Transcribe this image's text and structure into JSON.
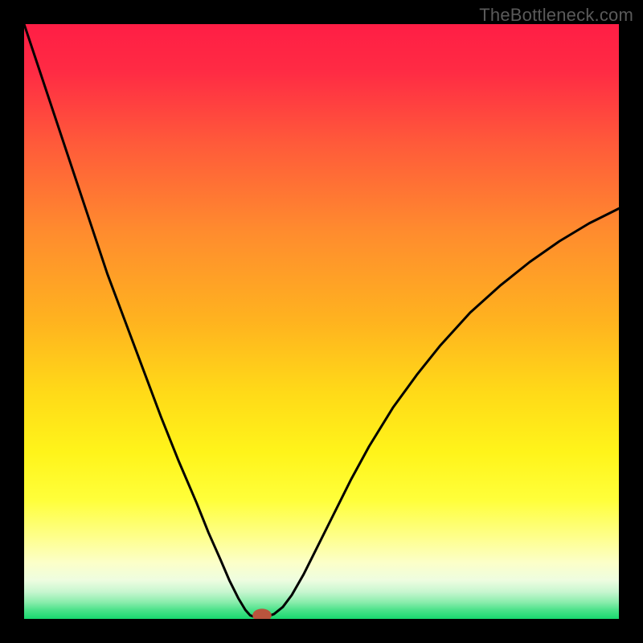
{
  "watermark": "TheBottleneck.com",
  "chart_data": {
    "type": "line",
    "title": "",
    "xlabel": "",
    "ylabel": "",
    "xlim": [
      0,
      100
    ],
    "ylim": [
      0,
      100
    ],
    "background_gradient": {
      "stops": [
        {
          "offset": 0.0,
          "color": "#ff1e45"
        },
        {
          "offset": 0.08,
          "color": "#ff2b44"
        },
        {
          "offset": 0.2,
          "color": "#ff5a3a"
        },
        {
          "offset": 0.35,
          "color": "#ff8c2e"
        },
        {
          "offset": 0.5,
          "color": "#ffb31f"
        },
        {
          "offset": 0.62,
          "color": "#ffda18"
        },
        {
          "offset": 0.72,
          "color": "#fff41a"
        },
        {
          "offset": 0.8,
          "color": "#ffff3a"
        },
        {
          "offset": 0.86,
          "color": "#feff88"
        },
        {
          "offset": 0.905,
          "color": "#fcffc8"
        },
        {
          "offset": 0.935,
          "color": "#eefde0"
        },
        {
          "offset": 0.955,
          "color": "#c6f6cf"
        },
        {
          "offset": 0.972,
          "color": "#8aedac"
        },
        {
          "offset": 0.985,
          "color": "#4ce28a"
        },
        {
          "offset": 1.0,
          "color": "#18d86e"
        }
      ]
    },
    "series": [
      {
        "name": "bottleneck-curve",
        "color": "#000000",
        "width": 3,
        "points": [
          {
            "x": 0.0,
            "y": 100.0
          },
          {
            "x": 2.0,
            "y": 94.0
          },
          {
            "x": 5.0,
            "y": 85.0
          },
          {
            "x": 8.0,
            "y": 76.0
          },
          {
            "x": 11.0,
            "y": 67.0
          },
          {
            "x": 14.0,
            "y": 58.0
          },
          {
            "x": 17.0,
            "y": 50.0
          },
          {
            "x": 20.0,
            "y": 42.0
          },
          {
            "x": 23.0,
            "y": 34.0
          },
          {
            "x": 26.0,
            "y": 26.5
          },
          {
            "x": 29.0,
            "y": 19.5
          },
          {
            "x": 31.0,
            "y": 14.5
          },
          {
            "x": 33.0,
            "y": 10.0
          },
          {
            "x": 34.5,
            "y": 6.5
          },
          {
            "x": 36.0,
            "y": 3.5
          },
          {
            "x": 37.2,
            "y": 1.5
          },
          {
            "x": 38.0,
            "y": 0.6
          },
          {
            "x": 38.8,
            "y": 0.3
          },
          {
            "x": 40.5,
            "y": 0.3
          },
          {
            "x": 42.0,
            "y": 0.8
          },
          {
            "x": 43.5,
            "y": 2.0
          },
          {
            "x": 45.0,
            "y": 4.0
          },
          {
            "x": 47.0,
            "y": 7.5
          },
          {
            "x": 49.0,
            "y": 11.5
          },
          {
            "x": 52.0,
            "y": 17.5
          },
          {
            "x": 55.0,
            "y": 23.5
          },
          {
            "x": 58.0,
            "y": 29.0
          },
          {
            "x": 62.0,
            "y": 35.5
          },
          {
            "x": 66.0,
            "y": 41.0
          },
          {
            "x": 70.0,
            "y": 46.0
          },
          {
            "x": 75.0,
            "y": 51.5
          },
          {
            "x": 80.0,
            "y": 56.0
          },
          {
            "x": 85.0,
            "y": 60.0
          },
          {
            "x": 90.0,
            "y": 63.5
          },
          {
            "x": 95.0,
            "y": 66.5
          },
          {
            "x": 100.0,
            "y": 69.0
          }
        ]
      }
    ],
    "marker": {
      "name": "optimum-point",
      "x": 40.0,
      "y": 0.6,
      "color": "#b9543d",
      "rx": 1.6,
      "ry": 1.1
    }
  }
}
